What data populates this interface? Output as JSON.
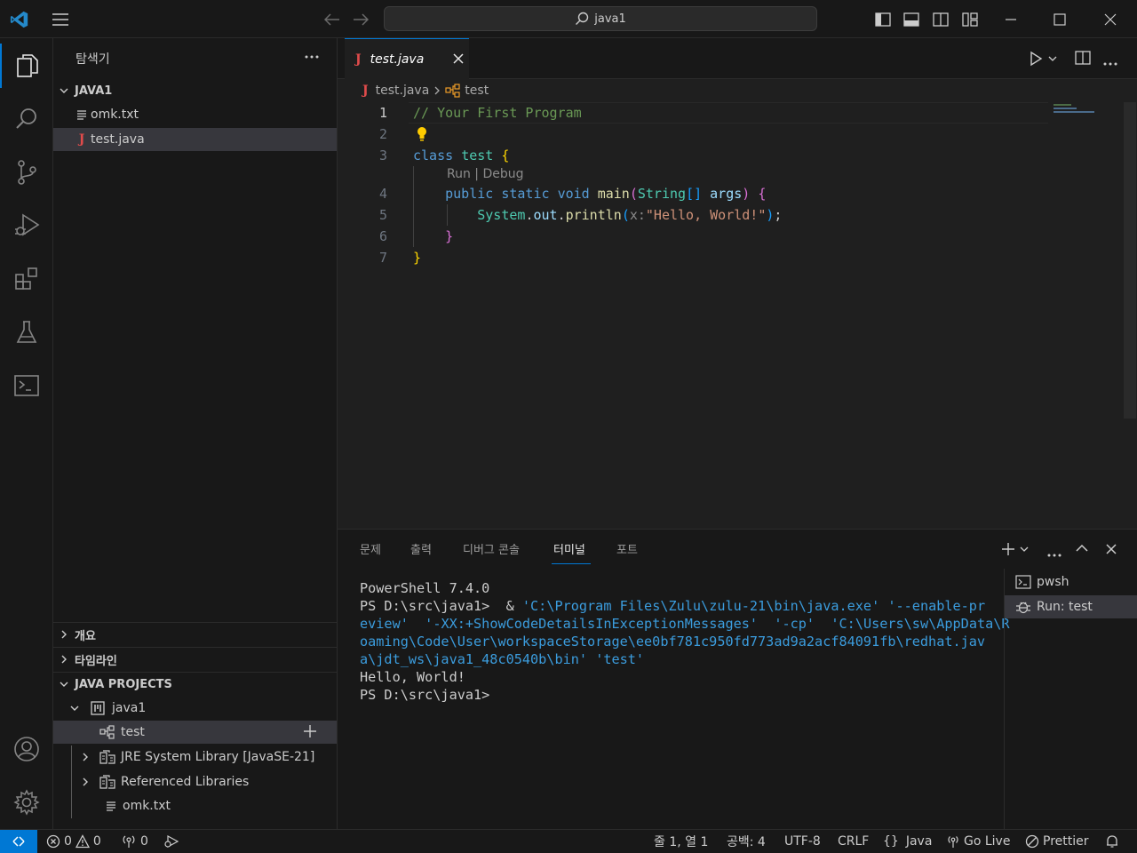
{
  "titlebar": {
    "search_text": "java1"
  },
  "sidebar": {
    "title": "탐색기",
    "workspace": "JAVA1",
    "files": [
      {
        "name": "omk.txt",
        "icon": "text-file-icon"
      },
      {
        "name": "test.java",
        "icon": "java-file-icon"
      }
    ],
    "outline": "개요",
    "timeline": "타임라인",
    "java_projects": {
      "title": "JAVA PROJECTS",
      "project": "java1",
      "items": [
        "test",
        "JRE System Library [JavaSE-21]",
        "Referenced Libraries",
        "omk.txt"
      ]
    }
  },
  "editor": {
    "tab_label": "test.java",
    "breadcrumb": {
      "file": "test.java",
      "symbol": "test"
    },
    "codelens": "Run | Debug",
    "line_numbers": [
      "1",
      "2",
      "3",
      "4",
      "5",
      "6",
      "7"
    ]
  },
  "panel": {
    "tabs": [
      "문제",
      "출력",
      "디버그 콘솔",
      "터미널",
      "포트"
    ],
    "active_tab": "터미널",
    "terminal_lines": [
      "PowerShell 7.4.0",
      "PS D:\\src\\java1> ",
      "eview'",
      "oaming\\Code\\User\\workspaceStorage\\ee0bf781c950fd773ad9a2acf84091fb\\redhat.jav",
      "a\\jdt_ws\\java1_48c0540b\\bin'",
      "Hello, World!",
      "PS D:\\src\\java1> "
    ],
    "terminals": [
      "pwsh",
      "Run: test"
    ]
  },
  "statusbar": {
    "errors": "0",
    "warnings": "0",
    "ports": "0",
    "position": "줄 1, 열 1",
    "indent": "공백: 4",
    "encoding": "UTF-8",
    "eol": "CRLF",
    "language": "Java",
    "golive": "Go Live",
    "prettier": "Prettier"
  },
  "colors": {
    "accent": "#0078d4",
    "java_red": "#e04b4b"
  }
}
